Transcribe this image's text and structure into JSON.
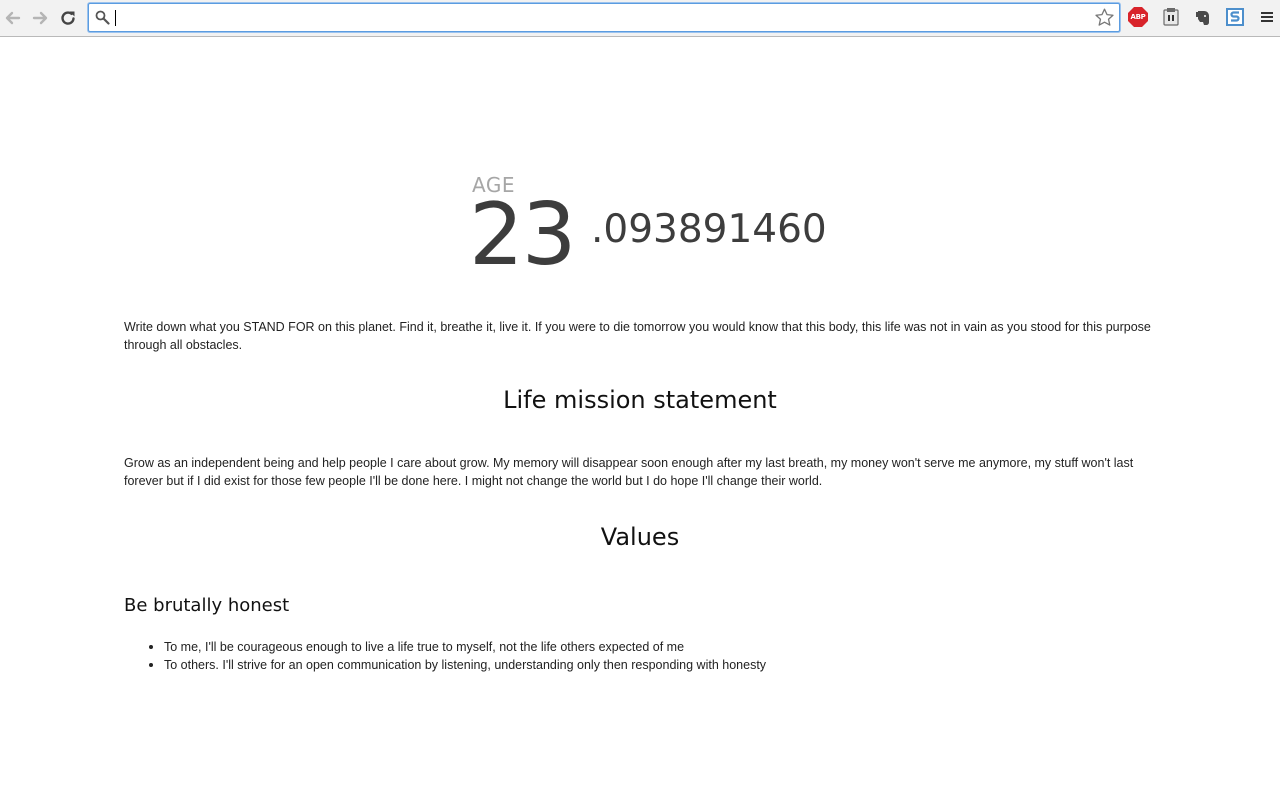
{
  "browser": {
    "address_value": "",
    "icons": {
      "back": "back-arrow-icon",
      "forward": "forward-arrow-icon",
      "reload": "reload-icon",
      "search": "search-icon",
      "bookmark": "bookmark-star-icon",
      "menu": "hamburger-menu-icon"
    },
    "extensions": [
      {
        "name": "adblock-plus",
        "label": "ABP",
        "color": "#d8232a"
      },
      {
        "name": "extension-badge",
        "label": ""
      },
      {
        "name": "evernote",
        "label": ""
      },
      {
        "name": "stylish",
        "label": ""
      }
    ]
  },
  "age": {
    "label": "AGE",
    "whole": "23",
    "fraction": ".093891460"
  },
  "intro": "Write down what you STAND FOR on this planet. Find it, breathe it, live it. If you were to die tomorrow you would know that this body, this life was not in vain as you stood for this purpose through all obstacles.",
  "mission": {
    "heading": "Life mission statement",
    "text": "Grow as an independent being and help people I care about grow. My memory will disappear soon enough after my last breath, my money won't serve me anymore, my stuff won't last forever but if I did exist for those few people I'll be done here. I might not change the world but I do hope I'll change their world."
  },
  "values": {
    "heading": "Values",
    "items": [
      {
        "title": "Be brutally honest",
        "points": [
          "To me, I'll be courageous enough to live a life true to myself, not the life others expected of me",
          "To others. I'll strive for an open communication by listening, understanding only then responding with honesty"
        ]
      }
    ]
  }
}
